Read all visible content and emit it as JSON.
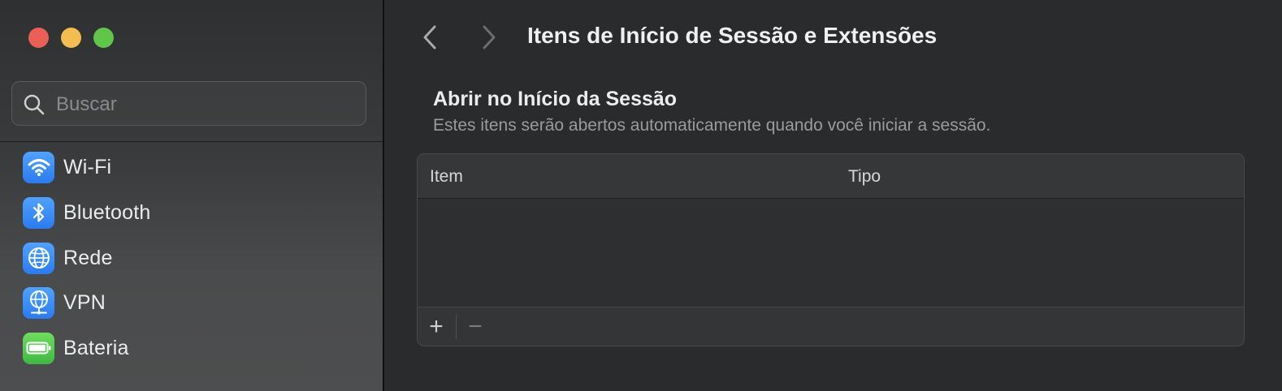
{
  "window": {
    "controls": [
      "close",
      "minimize",
      "zoom"
    ]
  },
  "sidebar": {
    "search": {
      "placeholder": "Buscar",
      "value": ""
    },
    "items": [
      {
        "label": "Wi-Fi",
        "icon": "wifi-icon",
        "color": "#2f86f6"
      },
      {
        "label": "Bluetooth",
        "icon": "bluetooth-icon",
        "color": "#2f86f6"
      },
      {
        "label": "Rede",
        "icon": "globe-icon",
        "color": "#2f86f6"
      },
      {
        "label": "VPN",
        "icon": "vpn-globe-icon",
        "color": "#2f86f6"
      },
      {
        "label": "Bateria",
        "icon": "battery-icon",
        "color": "#4cc64a"
      }
    ]
  },
  "main": {
    "title": "Itens de Início de Sessão e Extensões",
    "section": {
      "title": "Abrir no Início da Sessão",
      "subtitle": "Estes itens serão abertos automaticamente quando você iniciar a sessão."
    },
    "table": {
      "columns": [
        "Item",
        "Tipo"
      ],
      "rows": [],
      "add_label": "+",
      "remove_label": "−"
    }
  },
  "colors": {
    "accent_blue": "#2f86f6",
    "accent_green": "#4cc64a",
    "close": "#ec5f57",
    "minimize": "#f4bd4f",
    "zoom": "#5fc649"
  }
}
